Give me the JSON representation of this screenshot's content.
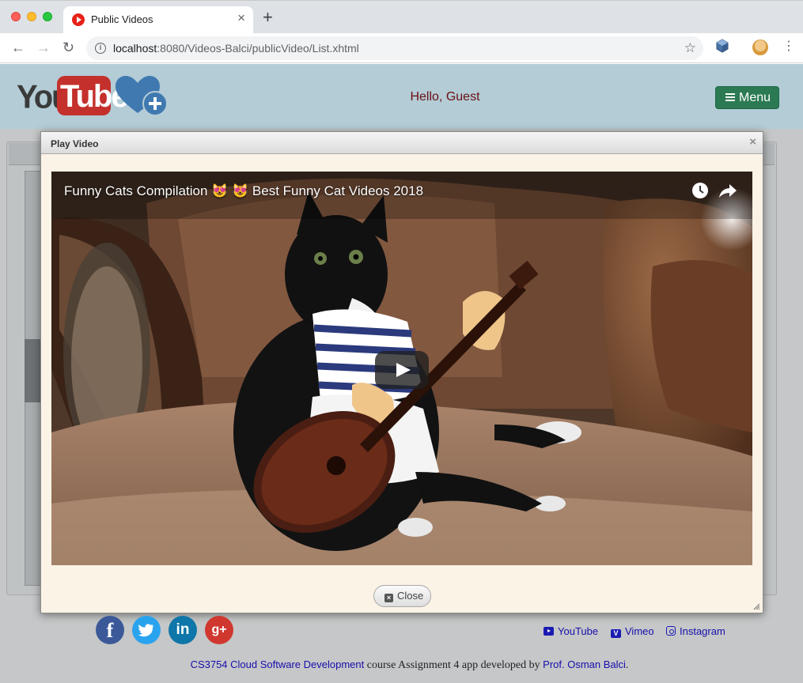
{
  "browser": {
    "tab_title": "Public Videos",
    "tab_close": "×",
    "new_tab": "+",
    "url_host": "localhost",
    "url_path": ":8080/Videos-Balci/publicVideo/List.xhtml"
  },
  "header": {
    "logo_you": "You",
    "logo_tube": "Tube",
    "greeting": "Hello, Guest",
    "menu_label": "Menu"
  },
  "dialog": {
    "title": "Play Video",
    "close_glyph": "×",
    "video_title": "Funny Cats Compilation 😻 😻  Best Funny Cat Videos 2018",
    "close_button": "Close",
    "close_button_icon": "×"
  },
  "footer": {
    "social": [
      {
        "name": "facebook-icon",
        "glyph": "f"
      },
      {
        "name": "twitter-icon",
        "glyph": "🐦"
      },
      {
        "name": "linkedin-icon",
        "glyph": "in"
      },
      {
        "name": "google-plus-icon",
        "glyph": "g+"
      }
    ],
    "links": {
      "youtube": "YouTube",
      "vimeo": "Vimeo",
      "vimeo_glyph": "V",
      "instagram": "Instagram"
    },
    "credit": {
      "course_link": "CS3754 Cloud Software Development",
      "middle_text": " course Assignment 4 app developed by ",
      "author_link": "Prof. Osman Balci",
      "end_text": "."
    }
  },
  "colors": {
    "header_bg": "#b3ccd6",
    "menu_button": "#2c7a53",
    "greeting_text": "#6b1012",
    "dialog_bg": "#fbf3e6",
    "link": "#1a0dab"
  }
}
